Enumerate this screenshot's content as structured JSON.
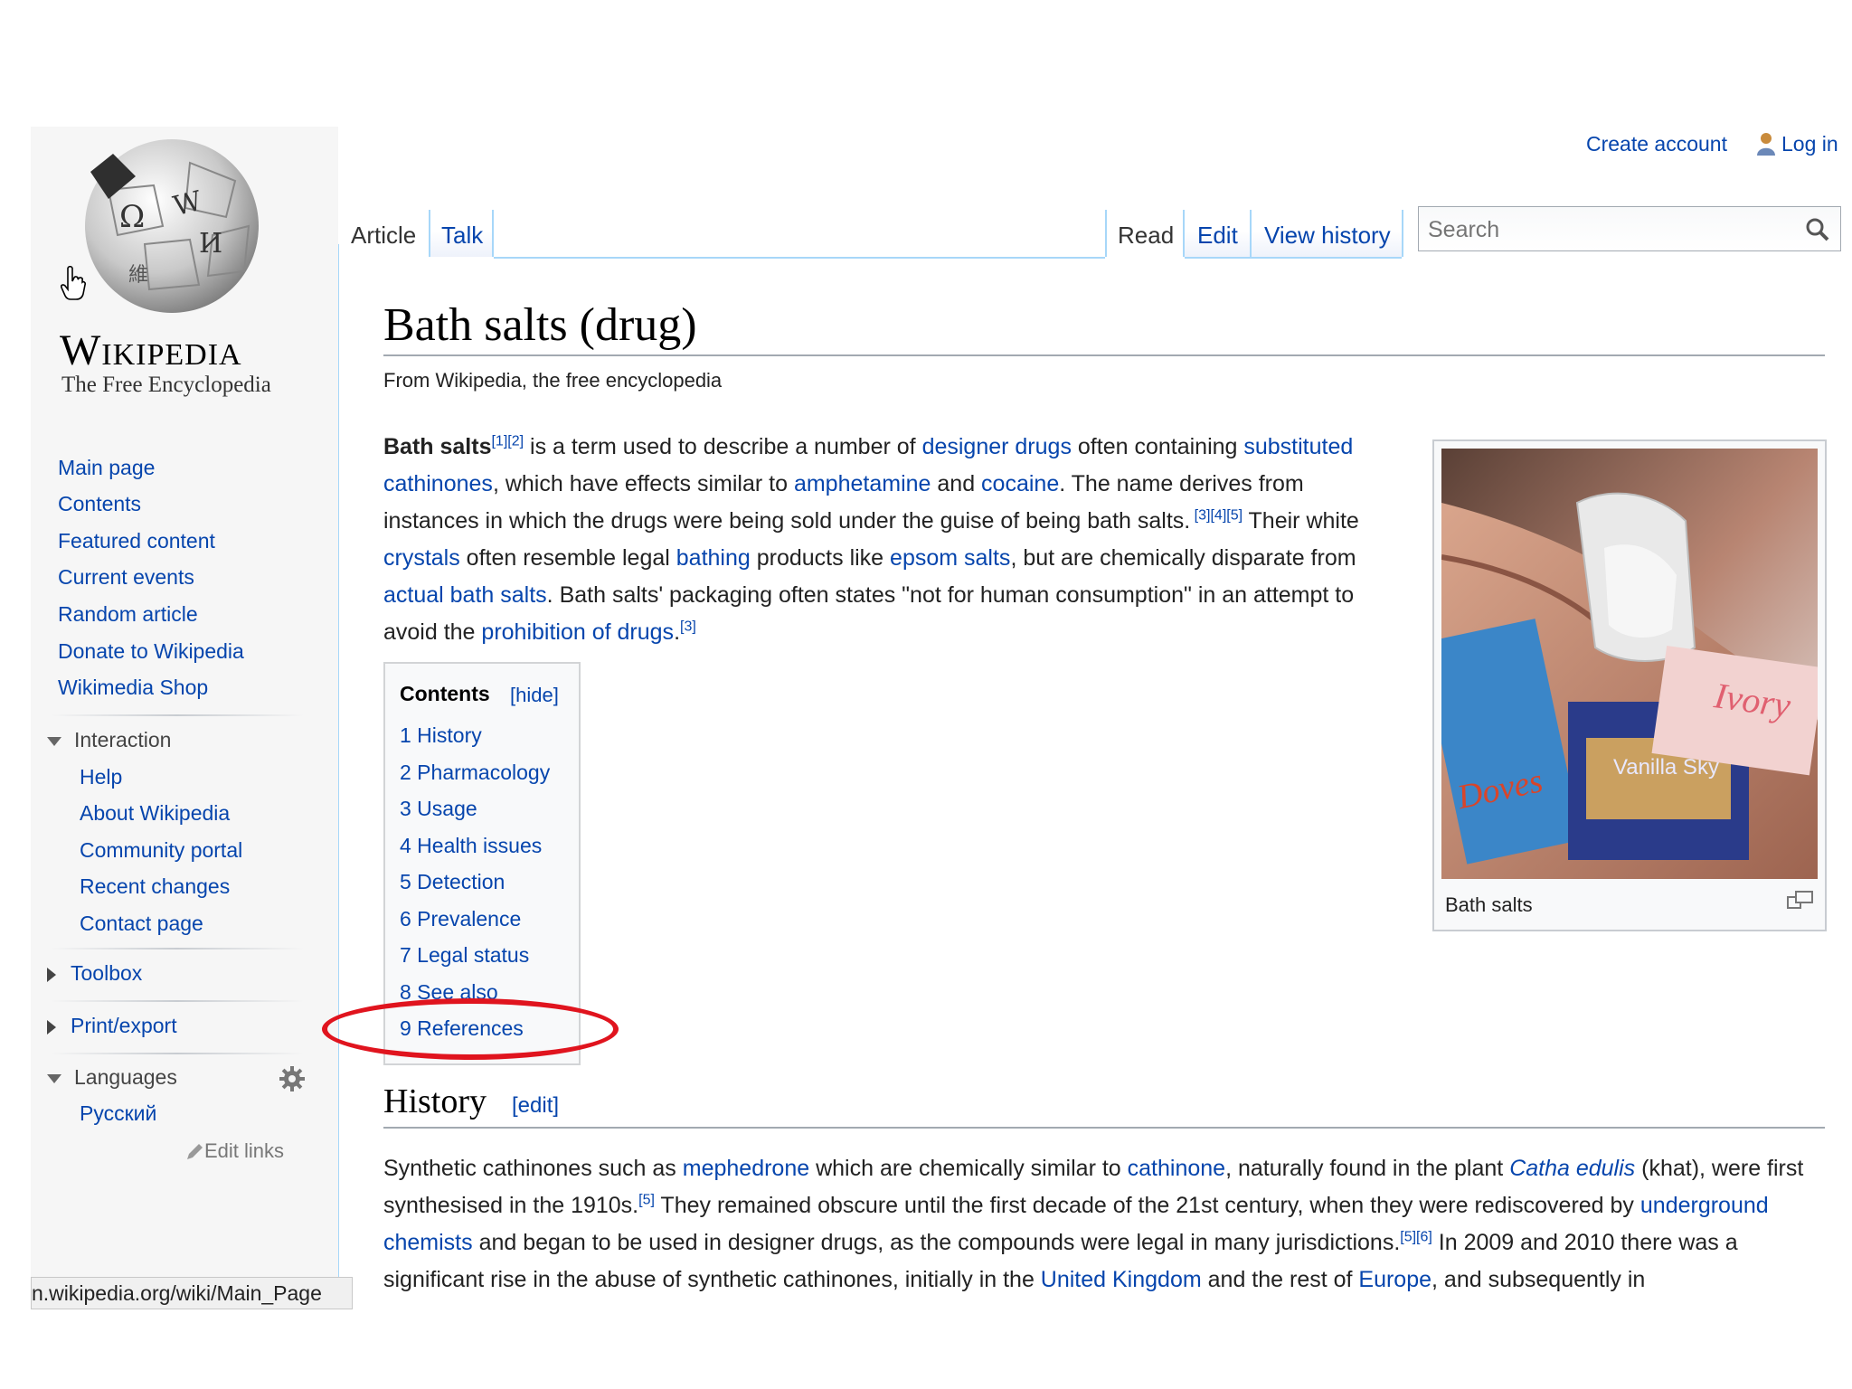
{
  "personal": {
    "create_account": "Create account",
    "log_in": "Log in"
  },
  "logo": {
    "wordmark": "Wikipedia",
    "tagline": "The Free Encyclopedia",
    "globe_glyphs": [
      "Ω",
      "W",
      "И",
      "維"
    ]
  },
  "sidebar": {
    "navigation": [
      "Main page",
      "Contents",
      "Featured content",
      "Current events",
      "Random article",
      "Donate to Wikipedia",
      "Wikimedia Shop"
    ],
    "interaction_heading": "Interaction",
    "interaction": [
      "Help",
      "About Wikipedia",
      "Community portal",
      "Recent changes",
      "Contact page"
    ],
    "toolbox": "Toolbox",
    "print_export": "Print/export",
    "languages_heading": "Languages",
    "languages": [
      "Русский"
    ],
    "edit_links": "Edit links"
  },
  "tabs": {
    "article": "Article",
    "talk": "Talk",
    "read": "Read",
    "edit": "Edit",
    "view_history": "View history"
  },
  "search": {
    "placeholder": "Search"
  },
  "page": {
    "title": "Bath salts (drug)",
    "tagline": "From Wikipedia, the free encyclopedia",
    "intro": [
      {
        "t": "Bath salts",
        "b": true
      },
      {
        "t": "[1][2]",
        "sup": true
      },
      {
        "t": " is a term used to describe a number of "
      },
      {
        "t": "designer drugs",
        "link": true
      },
      {
        "t": " often containing "
      },
      {
        "t": "substituted cathinones",
        "link": true
      },
      {
        "t": ", which have effects similar to "
      },
      {
        "t": "amphetamine",
        "link": true
      },
      {
        "t": " and "
      },
      {
        "t": "cocaine",
        "link": true
      },
      {
        "t": ". The name derives from instances in which the drugs were being sold under the guise of being bath salts."
      },
      {
        "t": " [3][4][5]",
        "sup": true
      },
      {
        "t": " Their white "
      },
      {
        "t": "crystals",
        "link": true
      },
      {
        "t": " often resemble legal "
      },
      {
        "t": "bathing",
        "link": true
      },
      {
        "t": " products like "
      },
      {
        "t": "epsom salts",
        "link": true
      },
      {
        "t": ", but are chemically disparate from "
      },
      {
        "t": "actual bath salts",
        "link": true
      },
      {
        "t": ". Bath salts' packaging often states \"not for human consumption\" in an attempt to avoid the "
      },
      {
        "t": "prohibition of drugs",
        "link": true
      },
      {
        "t": "."
      },
      {
        "t": "[3]",
        "sup": true
      }
    ],
    "toc": {
      "title": "Contents",
      "hide": "[hide]",
      "items": [
        "1 History",
        "2 Pharmacology",
        "3 Usage",
        "4 Health issues",
        "5 Detection",
        "6 Prevalence",
        "7 Legal status",
        "8 See also",
        "9 References"
      ]
    },
    "image_caption": "Bath salts",
    "image_labels": {
      "doves": "Doves",
      "ivory": "Ivory",
      "vanilla_sky": "Vanilla Sky"
    },
    "history_heading": "History",
    "history_edit": "[edit]",
    "history": [
      {
        "t": "Synthetic cathinones such as "
      },
      {
        "t": "mephedrone",
        "link": true
      },
      {
        "t": " which are chemically similar to "
      },
      {
        "t": "cathinone",
        "link": true
      },
      {
        "t": ", naturally found in the plant "
      },
      {
        "t": "Catha edulis",
        "link": true,
        "i": true
      },
      {
        "t": " (khat), were first synthesised in the 1910s."
      },
      {
        "t": "[5]",
        "sup": true
      },
      {
        "t": " They remained obscure until the first decade of the 21st century, when they were rediscovered by "
      },
      {
        "t": "underground chemists",
        "link": true
      },
      {
        "t": " and began to be used in designer drugs, as the compounds were legal in many jurisdictions."
      },
      {
        "t": "[5][6]",
        "sup": true
      },
      {
        "t": " In 2009 and 2010 there was a significant rise in the abuse of synthetic cathinones, initially in the "
      },
      {
        "t": "United Kingdom",
        "link": true
      },
      {
        "t": " and the rest of "
      },
      {
        "t": "Europe",
        "link": true
      },
      {
        "t": ", and subsequently in"
      }
    ]
  },
  "status_bar": {
    "url": "n.wikipedia.org/wiki/Main_Page"
  },
  "annotation": {
    "color": "#e0141e",
    "highlighted_item": "9 References"
  },
  "colors": {
    "link": "#0645ad",
    "tab_border": "#a7d7f9",
    "sidebar_bg": "#f6f6f6"
  }
}
